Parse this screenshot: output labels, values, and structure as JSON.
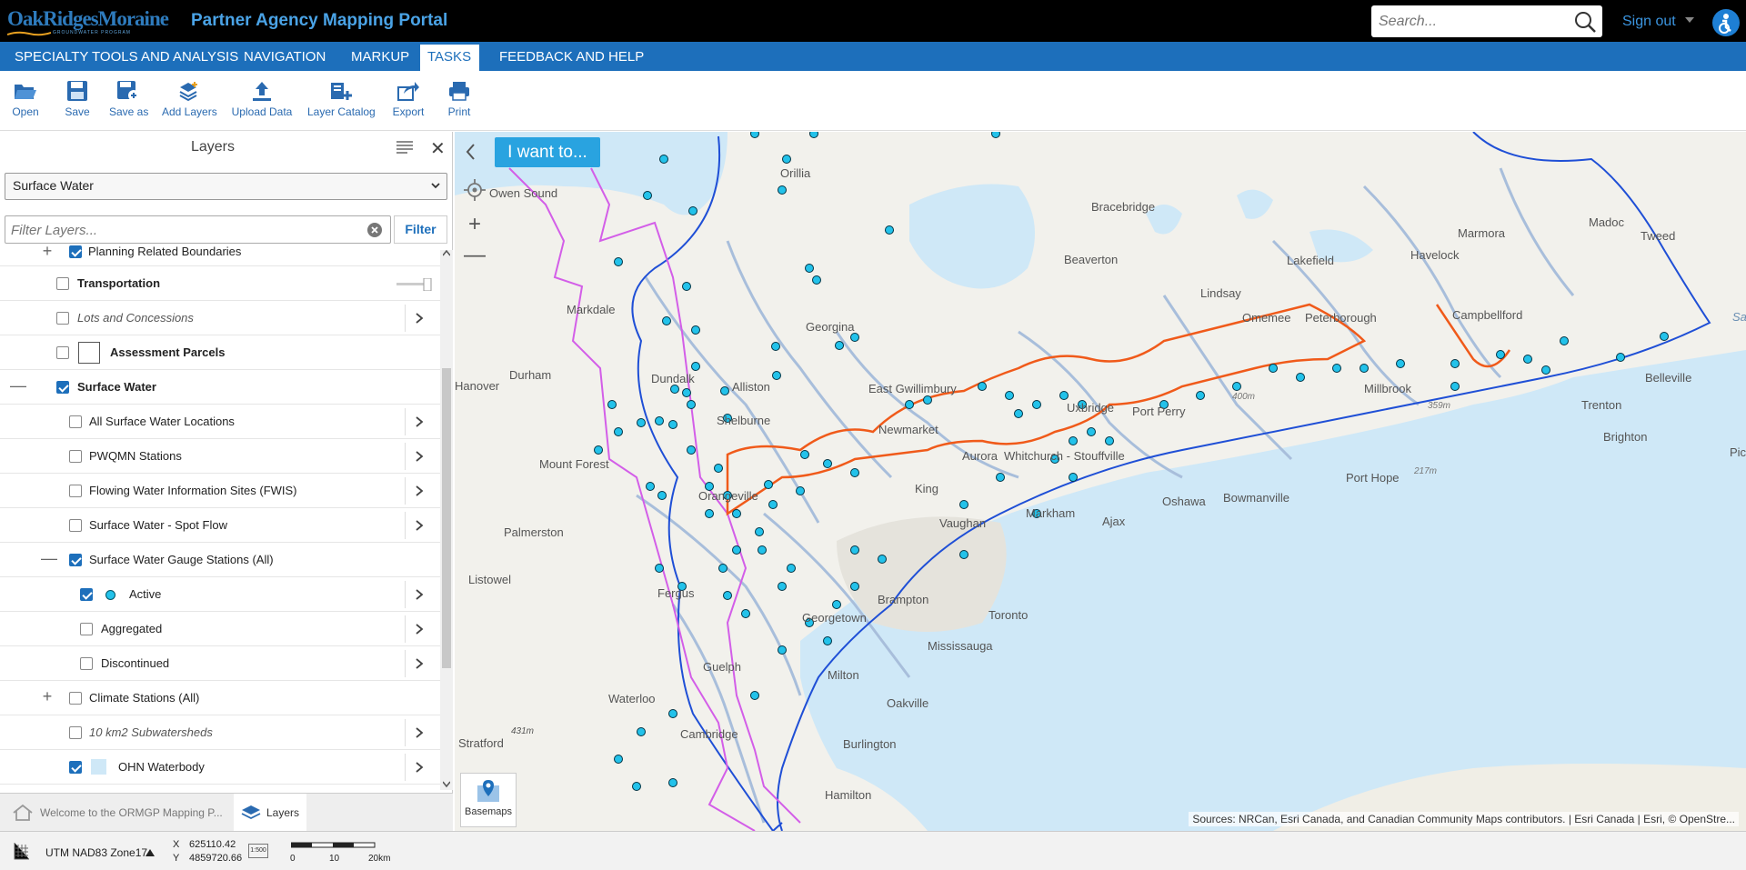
{
  "header": {
    "logo_text": "OakRidgesMoraine",
    "logo_sub": "GROUNDWATER PROGRAM",
    "app_title": "Partner Agency Mapping Portal",
    "search_placeholder": "Search...",
    "signout_label": "Sign out"
  },
  "menu": {
    "tabs": [
      {
        "label": "SPECIALTY TOOLS AND ANALYSIS"
      },
      {
        "label": "NAVIGATION"
      },
      {
        "label": "MARKUP"
      },
      {
        "label": "TASKS"
      },
      {
        "label": "FEEDBACK AND HELP"
      }
    ],
    "active": "TASKS"
  },
  "toolbar": {
    "open": "Open",
    "save": "Save",
    "save_as": "Save as",
    "add_layers": "Add Layers",
    "upload_data": "Upload Data",
    "layer_catalog": "Layer Catalog",
    "export": "Export",
    "print": "Print"
  },
  "panel": {
    "title": "Layers",
    "theme_selected": "Surface Water",
    "filter_placeholder": "Filter Layers...",
    "filter_button": "Filter",
    "layers": [
      {
        "label": "Planning Related Boundaries",
        "checked": true
      },
      {
        "label": "Transportation",
        "checked": false
      },
      {
        "label": "Lots and Concessions",
        "checked": false
      },
      {
        "label": "Assessment Parcels",
        "checked": false
      },
      {
        "label": "Surface Water",
        "checked": true
      },
      {
        "label": "All Surface Water Locations",
        "checked": false
      },
      {
        "label": "PWQMN Stations",
        "checked": false
      },
      {
        "label": "Flowing Water Information Sites (FWIS)",
        "checked": false
      },
      {
        "label": "Surface Water - Spot Flow",
        "checked": false
      },
      {
        "label": "Surface Water Gauge Stations (All)",
        "checked": true
      },
      {
        "label": "Active",
        "checked": true
      },
      {
        "label": "Aggregated",
        "checked": false
      },
      {
        "label": "Discontinued",
        "checked": false
      },
      {
        "label": "Climate Stations (All)",
        "checked": false
      },
      {
        "label": "10 km2 Subwatersheds",
        "checked": false
      },
      {
        "label": "OHN Waterbody",
        "checked": true
      }
    ]
  },
  "bottom_tabs": {
    "welcome": "Welcome to the ORMGP Mapping P...",
    "layers": "Layers"
  },
  "status": {
    "projection": "UTM NAD83 Zone17",
    "x_label": "X",
    "y_label": "Y",
    "x_value": "625110.42",
    "y_value": "4859720.66",
    "scale_0": "0",
    "scale_10": "10",
    "scale_20": "20km",
    "scale_badge": "1:500"
  },
  "map": {
    "i_want_to": "I want to...",
    "basemaps": "Basemaps",
    "attribution": "Sources: NRCan, Esri Canada, and Canadian Community Maps contributors. | Esri Canada | Esri, © OpenStre...",
    "labels": [
      "Owen Sound",
      "Orillia",
      "Bracebridge",
      "Marmora",
      "Madoc",
      "Tweed",
      "Beaverton",
      "Lakefield",
      "Havelock",
      "Markdale",
      "Lindsay",
      "Omemee",
      "Peterborough",
      "Campbellford",
      "Georgina",
      "Durham",
      "Hanover",
      "Dundalk",
      "Alliston",
      "East Gwillimbury",
      "Uxbridge",
      "Port Perry",
      "Millbrook",
      "Belleville",
      "Shelburne",
      "Newmarket",
      "Trenton",
      "Brighton",
      "Mount Forest",
      "Aurora",
      "Whitchurch - Stouffville",
      "Orangeville",
      "King",
      "Markham",
      "Oshawa",
      "Bowmanville",
      "Port Hope",
      "Palmerston",
      "Vaughan",
      "Ajax",
      "Listowel",
      "Fergus",
      "Brampton",
      "Georgetown",
      "Toronto",
      "Mississauga",
      "Guelph",
      "Milton",
      "Waterloo",
      "Oakville",
      "Cambridge",
      "Burlington",
      "Stratford",
      "Hamilton",
      "Picton",
      "Sandbanks",
      "431m",
      "400m",
      "359m",
      "217m"
    ]
  },
  "colors": {
    "menu_blue": "#1d6fbb",
    "title_blue": "#4aa3e6",
    "iwant_blue": "#29a3e0",
    "watershed_blue": "#1f4fd6",
    "moraine_orange": "#f05a1a",
    "boundary_magenta": "#d35ee8",
    "lake_blue": "#cfe8f7",
    "station_cyan": "#23c2ea"
  }
}
